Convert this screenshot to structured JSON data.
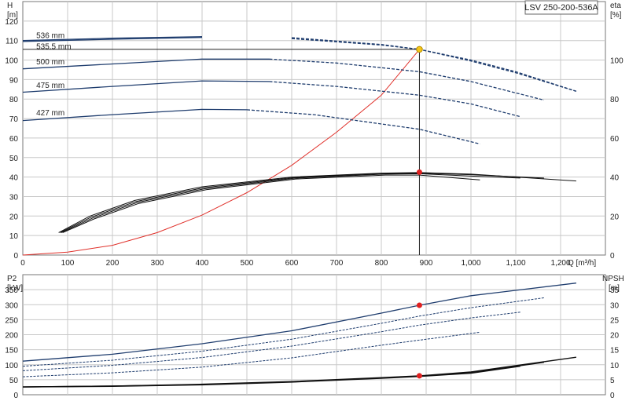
{
  "pump_label": "LSV 250-200-536A",
  "chart_data": [
    {
      "id": "head_efficiency",
      "type": "line",
      "xlabel": "Q [m³/h]",
      "ylabel_left": [
        "H",
        "[m]"
      ],
      "ylabel_right": [
        "eta",
        "[%]"
      ],
      "xlim": [
        0,
        1300
      ],
      "ylim": [
        0,
        130
      ],
      "ylim_right": [
        0,
        130
      ],
      "x_ticks": [
        "0",
        "100",
        "200",
        "300",
        "400",
        "500",
        "600",
        "700",
        "800",
        "900",
        "1,000",
        "1,100",
        "1,200"
      ],
      "y_ticks": [
        0,
        10,
        20,
        30,
        40,
        50,
        60,
        70,
        80,
        90,
        100,
        110,
        120
      ],
      "y_right_ticks": [
        0,
        20,
        40,
        60,
        80,
        100
      ],
      "grid": true,
      "head_curves": [
        {
          "name": "536 mm",
          "color": "#1f3d6e",
          "points": [
            [
              0,
              110
            ],
            [
              200,
              111.2
            ],
            [
              400,
              112
            ],
            [
              600,
              111.5
            ],
            [
              800,
              108
            ],
            [
              885,
              105.5
            ],
            [
              1000,
              100
            ],
            [
              1100,
              94
            ],
            [
              1235,
              84
            ]
          ]
        },
        {
          "name": "535.5 mm",
          "color": "#1f3d6e",
          "points": [
            [
              0,
              109.5
            ],
            [
              200,
              110.7
            ],
            [
              400,
              111.6
            ],
            [
              600,
              111
            ],
            [
              800,
              107.7
            ],
            [
              885,
              105.5
            ],
            [
              1000,
              99.5
            ],
            [
              1100,
              93.5
            ],
            [
              1235,
              84
            ]
          ]
        },
        {
          "name": "500 mm",
          "color": "#1f3d6e",
          "points": [
            [
              0,
              95.5
            ],
            [
              200,
              98
            ],
            [
              400,
              100.5
            ],
            [
              550,
              100.5
            ],
            [
              700,
              98.5
            ],
            [
              885,
              94
            ],
            [
              1000,
              89
            ],
            [
              1163,
              79.5
            ]
          ]
        },
        {
          "name": "475 mm",
          "color": "#1f3d6e",
          "points": [
            [
              0,
              83.5
            ],
            [
              200,
              86.5
            ],
            [
              400,
              89.3
            ],
            [
              550,
              89
            ],
            [
              700,
              86.5
            ],
            [
              885,
              82
            ],
            [
              1000,
              77.5
            ],
            [
              1110,
              71
            ]
          ]
        },
        {
          "name": "427 mm",
          "color": "#1f3d6e",
          "points": [
            [
              0,
              69
            ],
            [
              200,
              72
            ],
            [
              400,
              74.7
            ],
            [
              500,
              74.5
            ],
            [
              650,
              72
            ],
            [
              885,
              64.5
            ],
            [
              1020,
              57
            ]
          ]
        }
      ],
      "efficiency_curves": [
        {
          "color": "#111111",
          "points": [
            [
              80,
              11.5
            ],
            [
              150,
              20
            ],
            [
              250,
              28
            ],
            [
              400,
              35
            ],
            [
              600,
              40
            ],
            [
              800,
              42
            ],
            [
              885,
              42.3
            ],
            [
              1000,
              41.5
            ],
            [
              1235,
              38
            ]
          ]
        },
        {
          "color": "#111111",
          "points": [
            [
              83,
              11.5
            ],
            [
              153,
              19.5
            ],
            [
              253,
              27.5
            ],
            [
              403,
              34.5
            ],
            [
              603,
              39.7
            ],
            [
              803,
              41.8
            ],
            [
              885,
              42
            ],
            [
              1000,
              41.2
            ],
            [
              1163,
              39.5
            ]
          ]
        },
        {
          "color": "#111111",
          "points": [
            [
              86,
              11.5
            ],
            [
              156,
              19
            ],
            [
              256,
              27
            ],
            [
              406,
              34
            ],
            [
              606,
              39.4
            ],
            [
              806,
              41.5
            ],
            [
              885,
              41.7
            ],
            [
              1000,
              40.5
            ],
            [
              1110,
              39.5
            ]
          ]
        },
        {
          "color": "#111111",
          "points": [
            [
              89,
              11.5
            ],
            [
              159,
              18.5
            ],
            [
              259,
              26.5
            ],
            [
              409,
              33.5
            ],
            [
              609,
              39
            ],
            [
              809,
              41
            ],
            [
              885,
              41
            ],
            [
              1020,
              38.5
            ]
          ]
        }
      ],
      "system_curve": {
        "color": "#e0302a",
        "points": [
          [
            0,
            0
          ],
          [
            100,
            1.5
          ],
          [
            200,
            5
          ],
          [
            300,
            11.5
          ],
          [
            400,
            20.5
          ],
          [
            500,
            32
          ],
          [
            600,
            46
          ],
          [
            700,
            63
          ],
          [
            800,
            82
          ],
          [
            885,
            105.5
          ]
        ]
      },
      "operating_point": {
        "q": 885,
        "h": 105.5,
        "eta_point_h": 42.5,
        "marker_color": "#f5c518",
        "eta_marker_color": "#e02020"
      }
    },
    {
      "id": "power_npsh",
      "type": "line",
      "ylabel_left": [
        "P2",
        "[kW]"
      ],
      "ylabel_right": [
        "NPSH",
        "[m]"
      ],
      "xlim": [
        0,
        1300
      ],
      "ylim": [
        0,
        400
      ],
      "ylim_right": [
        0,
        40
      ],
      "y_ticks": [
        0,
        50,
        100,
        150,
        200,
        250,
        300,
        350
      ],
      "y_right_ticks": [
        0,
        5,
        10,
        15,
        20,
        25,
        30,
        35
      ],
      "grid": true,
      "power_curves": [
        {
          "color": "#1f3d6e",
          "points": [
            [
              0,
              112
            ],
            [
              200,
              135
            ],
            [
              400,
              170
            ],
            [
              600,
              213
            ],
            [
              800,
              272
            ],
            [
              885,
              298
            ],
            [
              1000,
              330
            ],
            [
              1235,
              372
            ]
          ]
        },
        {
          "color": "#1f3d6e",
          "points": [
            [
              0,
              95
            ],
            [
              200,
              115
            ],
            [
              400,
              145
            ],
            [
              600,
              185
            ],
            [
              800,
              238
            ],
            [
              885,
              262
            ],
            [
              1000,
              290
            ],
            [
              1163,
              323
            ]
          ]
        },
        {
          "color": "#1f3d6e",
          "points": [
            [
              0,
              80
            ],
            [
              200,
              98
            ],
            [
              400,
              124
            ],
            [
              600,
              162
            ],
            [
              800,
              210
            ],
            [
              885,
              232
            ],
            [
              1000,
              256
            ],
            [
              1110,
              275
            ]
          ]
        },
        {
          "color": "#1f3d6e",
          "points": [
            [
              0,
              60
            ],
            [
              200,
              73
            ],
            [
              400,
              92
            ],
            [
              600,
              123
            ],
            [
              800,
              165
            ],
            [
              885,
              182
            ],
            [
              1020,
              208
            ]
          ]
        }
      ],
      "npsh_curves": [
        {
          "color": "#111111",
          "points": [
            [
              0,
              2.6
            ],
            [
              200,
              2.9
            ],
            [
              400,
              3.5
            ],
            [
              600,
              4.4
            ],
            [
              800,
              5.7
            ],
            [
              885,
              6.3
            ],
            [
              1000,
              7.6
            ],
            [
              1235,
              12.5
            ]
          ]
        },
        {
          "color": "#111111",
          "points": [
            [
              0,
              2.6
            ],
            [
              200,
              2.9
            ],
            [
              400,
              3.4
            ],
            [
              600,
              4.3
            ],
            [
              800,
              5.6
            ],
            [
              885,
              6.2
            ],
            [
              1000,
              7.4
            ],
            [
              1163,
              10.8
            ]
          ]
        },
        {
          "color": "#111111",
          "points": [
            [
              0,
              2.6
            ],
            [
              200,
              2.8
            ],
            [
              400,
              3.3
            ],
            [
              600,
              4.2
            ],
            [
              800,
              5.5
            ],
            [
              885,
              6.1
            ],
            [
              1000,
              7.2
            ],
            [
              1110,
              9.5
            ]
          ]
        }
      ],
      "operating_point": {
        "q": 885,
        "p2": 298,
        "npsh": 6.3,
        "marker_color": "#e02020"
      }
    }
  ]
}
